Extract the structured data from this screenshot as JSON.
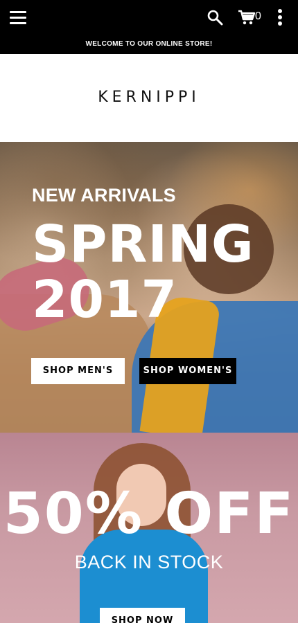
{
  "header": {
    "welcome_text": "WELCOME TO OUR ONLINE STORE!",
    "cart_count": "0",
    "icons": {
      "menu": "hamburger-menu-icon",
      "search": "search-icon",
      "cart": "cart-icon",
      "more": "more-vertical-icon"
    }
  },
  "logo": {
    "text": "KERNIPPI"
  },
  "hero_spring": {
    "subtitle": "NEW ARRIVALS",
    "title_line1": "SPRING",
    "title_line2": "2017",
    "button_men": "SHOP MEN'S",
    "button_women": "SHOP WOMEN'S"
  },
  "hero_sale": {
    "title": "50% OFF",
    "subtitle": "BACK IN STOCK",
    "button": "SHOP NOW"
  },
  "colors": {
    "topbar_bg": "#000000",
    "button_light_bg": "#ffffff",
    "button_dark_bg": "#000000",
    "text_on_image": "#ffffff"
  }
}
